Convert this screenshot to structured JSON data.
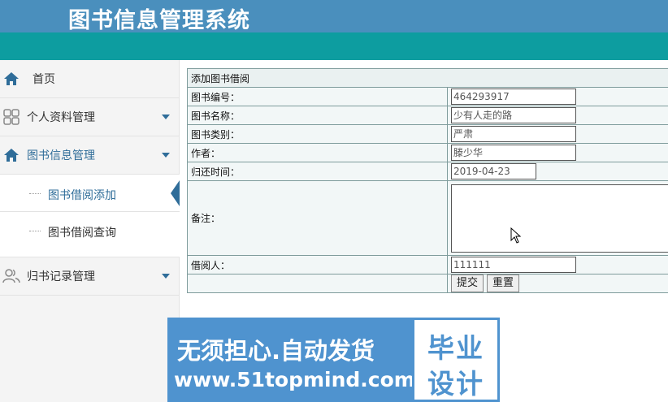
{
  "header": {
    "title": "图书信息管理系统"
  },
  "sidebar": {
    "items": [
      {
        "label": "首页",
        "icon": "home-icon"
      },
      {
        "label": "个人资料管理",
        "icon": "grid-icon"
      },
      {
        "label": "图书信息管理",
        "icon": "home-icon"
      },
      {
        "label": "归书记录管理",
        "icon": "users-icon"
      }
    ],
    "sub_items": [
      {
        "label": "图书借阅添加"
      },
      {
        "label": "图书借阅查询"
      }
    ]
  },
  "form": {
    "title": "添加图书借阅",
    "fields": [
      {
        "label": "图书编号：",
        "value": "464293917"
      },
      {
        "label": "图书名称：",
        "value": "少有人走的路"
      },
      {
        "label": "图书类别：",
        "value": "严肃"
      },
      {
        "label": "作者：",
        "value": "滕少华"
      },
      {
        "label": "归还时间：",
        "value": "2019-04-23"
      },
      {
        "label": "备注：",
        "value": ""
      },
      {
        "label": "借阅人：",
        "value": "111111"
      }
    ],
    "submit_label": "提交",
    "reset_label": "重置"
  },
  "watermark": {
    "line1": "无须担心.自动发货",
    "line2": "www.51topmind.com",
    "right1": "毕业",
    "right2": "设计"
  },
  "colors": {
    "header": "#4a8fbd",
    "teal_bar": "#0d9da0",
    "accent": "#2f6d99",
    "watermark": "#4f93cf"
  }
}
